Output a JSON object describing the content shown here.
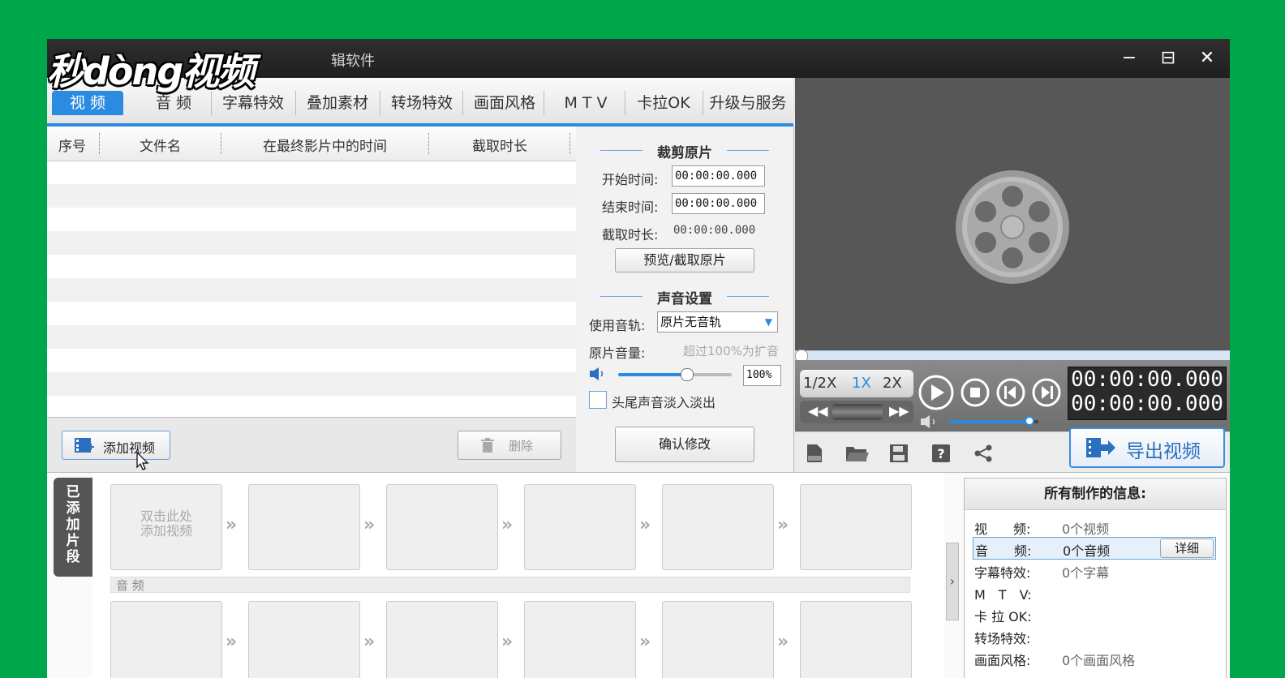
{
  "window": {
    "title_partial": "辑软件",
    "watermark": "秒dòng视频",
    "controls": [
      "−",
      "⊟",
      "✕"
    ]
  },
  "tabs": [
    {
      "label": "视 频",
      "active": true
    },
    {
      "label": "音 频",
      "active": false
    },
    {
      "label": "字幕特效",
      "active": false
    },
    {
      "label": "叠加素材",
      "active": false
    },
    {
      "label": "转场特效",
      "active": false
    },
    {
      "label": "画面风格",
      "active": false
    },
    {
      "label": "M T V",
      "active": false
    },
    {
      "label": "卡拉OK",
      "active": false
    },
    {
      "label": "升级与服务",
      "active": false
    }
  ],
  "file_list": {
    "columns": [
      "序号",
      "文件名",
      "在最终影片中的时间",
      "截取时长"
    ],
    "rows": []
  },
  "list_actions": {
    "add_label": "添加视频",
    "delete_label": "删除"
  },
  "trim": {
    "heading": "裁剪原片",
    "start_label": "开始时间:",
    "start_value": "00:00:00.000",
    "end_label": "结束时间:",
    "end_value": "00:00:00.000",
    "duration_label": "截取时长:",
    "duration_value": "00:00:00.000",
    "preview_button": "预览/截取原片"
  },
  "audio": {
    "heading": "声音设置",
    "track_label": "使用音轨:",
    "track_value": "原片无音轨",
    "volume_label": "原片音量:",
    "volume_hint": "超过100%为扩音",
    "volume_value": "100%",
    "volume_level": 0.6,
    "fade_label": "头尾声音淡入淡出",
    "fade_checked": false,
    "confirm_button": "确认修改"
  },
  "player": {
    "speeds": [
      "1/2X",
      "1X",
      "2X"
    ],
    "active_speed": "1X",
    "time_current": "00:00:00.000",
    "time_total": "00:00:00.000",
    "volume_level": 0.9,
    "export_label": "导出视频"
  },
  "toolbar_icons": [
    "new-file-icon",
    "open-folder-icon",
    "save-icon",
    "help-icon",
    "share-icon"
  ],
  "clips": {
    "side_label": "已添加片段",
    "first_slot_text": "双击此处\n添加视频",
    "video_slot_count": 6,
    "audio_label": "音 频",
    "audio_slot_count": 6
  },
  "info": {
    "heading": "所有制作的信息:",
    "rows": [
      {
        "key": "视　　频:",
        "value": "0个视频",
        "highlight": false
      },
      {
        "key": "音　　频:",
        "value": "0个音频",
        "highlight": true,
        "detail": "详细"
      },
      {
        "key": "字幕特效:",
        "value": "0个字幕",
        "highlight": false
      },
      {
        "key": "M　T　V:",
        "value": "",
        "highlight": false
      },
      {
        "key": "卡 拉 OK:",
        "value": "",
        "highlight": false
      },
      {
        "key": "转场特效:",
        "value": "",
        "highlight": false
      },
      {
        "key": "画面风格:",
        "value": "0个画面风格",
        "highlight": false
      }
    ]
  }
}
